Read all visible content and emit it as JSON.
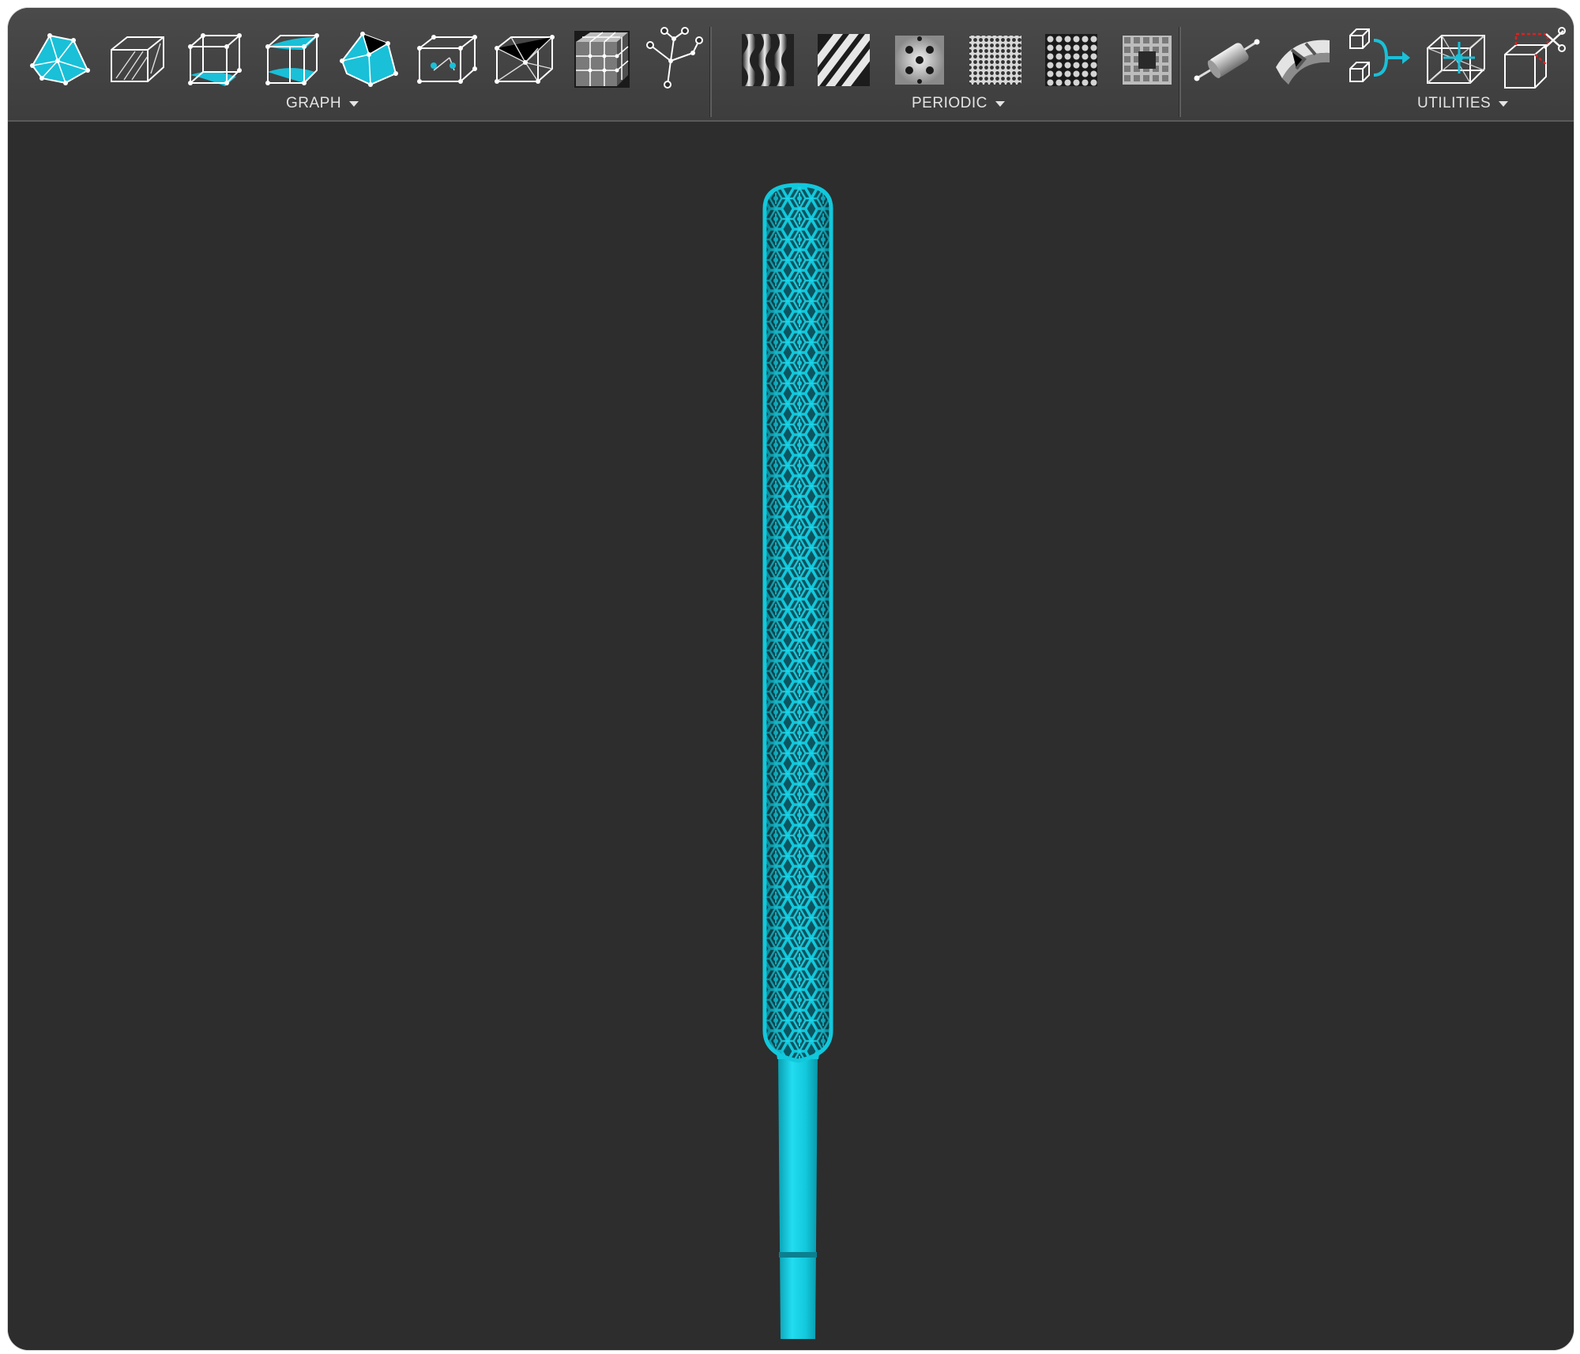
{
  "toolbar": {
    "groups": [
      {
        "label": "GRAPH",
        "tools": [
          {
            "icon": "surface-graph-icon"
          },
          {
            "icon": "planar-lattice-icon"
          },
          {
            "icon": "conformal-lattice-icon"
          },
          {
            "icon": "surface-lattice-icon"
          },
          {
            "icon": "voronoi-surface-icon"
          },
          {
            "icon": "volume-lattice-icon"
          },
          {
            "icon": "tetrahedral-lattice-icon"
          },
          {
            "icon": "grid-lattice-icon"
          },
          {
            "icon": "custom-graph-icon"
          }
        ]
      },
      {
        "label": "PERIODIC",
        "tools": [
          {
            "icon": "wave-pattern-icon"
          },
          {
            "icon": "stripe-pattern-icon"
          },
          {
            "icon": "dot-pattern-icon"
          },
          {
            "icon": "fine-grid-pattern-icon"
          },
          {
            "icon": "hole-grid-pattern-icon"
          },
          {
            "icon": "square-pattern-icon"
          }
        ]
      },
      {
        "label": "UTILITIES",
        "tools": [
          {
            "icon": "strut-cylinder-icon"
          },
          {
            "icon": "thicken-surface-icon"
          },
          {
            "icon": "merge-lattice-icon"
          },
          {
            "icon": "node-edit-icon"
          },
          {
            "icon": "trim-lattice-icon"
          }
        ]
      }
    ]
  },
  "colors": {
    "accent": "#12c8dc",
    "toolbar_bg": "#424242",
    "viewport_bg": "#2d2d2d"
  }
}
